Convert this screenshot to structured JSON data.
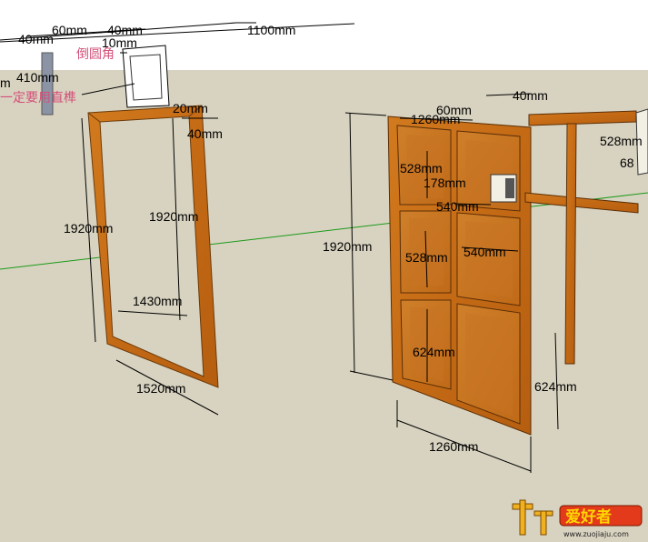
{
  "scene": {
    "ground_color": "#d8d3c0",
    "sky_color": "#ffffff",
    "wood_color": "#c8731c",
    "axis_green": "#1a9a1a"
  },
  "top_labels": {
    "d60": "60mm",
    "d40": "40mm",
    "d10": "10mm",
    "d1100": "1100mm",
    "d410": "410mm",
    "d40b": "40mm",
    "m": "m"
  },
  "notes": {
    "fillet": "倒圆角",
    "tenon": "一定要用直榫"
  },
  "frame_labels": {
    "h_left": "1920mm",
    "h_right": "1920mm",
    "inner_w": "1430mm",
    "outer_w": "1520mm",
    "top_20": "20mm",
    "top_40": "40mm"
  },
  "door_labels": {
    "h": "1920mm",
    "w_top": "1260mm",
    "w_bottom": "1260mm",
    "d60": "60mm",
    "d40": "40mm",
    "p528a": "528mm",
    "p528b": "528mm",
    "p178": "178mm",
    "p540": "540mm",
    "p540b": "540mm",
    "p624": "624mm",
    "p624r": "624mm",
    "p528r": "528mm",
    "p68": "68"
  },
  "watermark": {
    "brand": "爱好者",
    "url": "www.zuojiaju.com"
  }
}
